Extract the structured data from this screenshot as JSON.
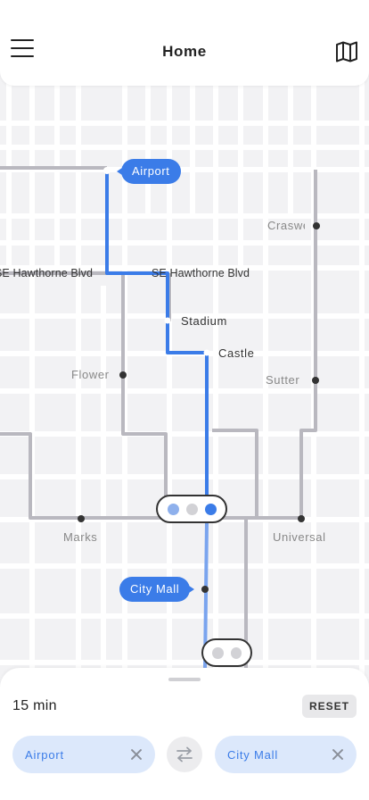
{
  "header": {
    "title": "Home",
    "menu_icon": "hamburger-menu-icon",
    "map_icon": "folded-map-icon"
  },
  "map": {
    "streets": [
      "SE Hawthorne Blvd",
      "SE Hawthorne Blvd"
    ],
    "stops": {
      "origin": "Airport",
      "destination": "City Mall",
      "route_stops": [
        "Stadium",
        "Castle"
      ],
      "other_stops": [
        "Craswell",
        "Flower",
        "Sutter",
        "Marks",
        "Universal"
      ]
    },
    "transfer_pill_top": {
      "dots": 3,
      "active_index": 2
    },
    "transfer_pill_bottom": {
      "dots": 2
    },
    "colors": {
      "route": "#3b7ce8",
      "route_light": "#7aa4ee",
      "other_line": "#b9b8bf",
      "road": "#ffffff",
      "block": "#f2f2f4"
    }
  },
  "sheet": {
    "duration": "15 min",
    "reset_label": "RESET",
    "from": {
      "label": "Airport"
    },
    "to": {
      "label": "City Mall"
    },
    "swap_icon": "swap-arrows-icon",
    "clear_icon": "close-icon"
  }
}
